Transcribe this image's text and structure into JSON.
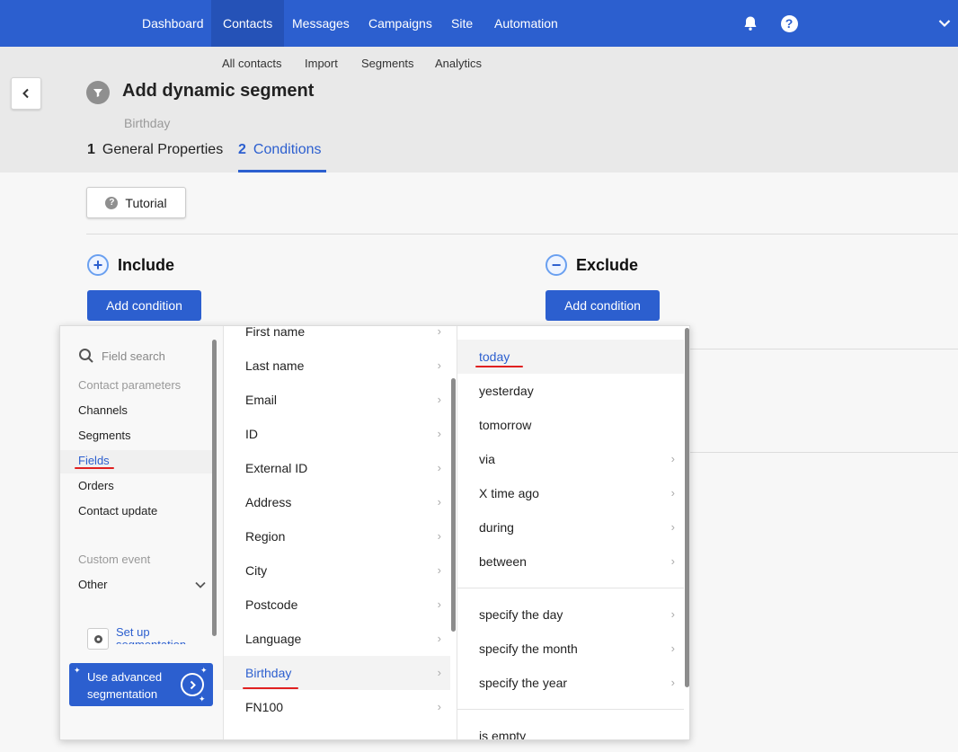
{
  "nav": {
    "items": [
      "Dashboard",
      "Contacts",
      "Messages",
      "Campaigns",
      "Site",
      "Automation"
    ],
    "active": "Contacts"
  },
  "subnav": [
    "All contacts",
    "Import",
    "Segments",
    "Analytics"
  ],
  "page": {
    "title": "Add dynamic segment",
    "subtitle": "Birthday"
  },
  "steps": [
    {
      "num": "1",
      "label": "General Properties"
    },
    {
      "num": "2",
      "label": "Conditions"
    }
  ],
  "tutorial_label": "Tutorial",
  "include": {
    "title": "Include",
    "add_label": "Add condition"
  },
  "exclude": {
    "title": "Exclude",
    "add_label": "Add condition"
  },
  "col1": {
    "search_placeholder": "Field search",
    "group1_label": "Contact parameters",
    "group1_items": [
      "Channels",
      "Segments",
      "Fields",
      "Orders",
      "Contact update"
    ],
    "active": "Fields",
    "group2_label": "Custom event",
    "other_label": "Other",
    "setup_label": "Set up segmentation",
    "advanced_label": "Use advanced segmentation"
  },
  "col2": {
    "items": [
      "First name",
      "Last name",
      "Email",
      "ID",
      "External ID",
      "Address",
      "Region",
      "City",
      "Postcode",
      "Language",
      "Birthday",
      "FN100"
    ],
    "active": "Birthday"
  },
  "col3": {
    "group1": [
      "today",
      "yesterday",
      "tomorrow",
      "via",
      "X time ago",
      "during",
      "between"
    ],
    "group2": [
      "specify the day",
      "specify the month",
      "specify the year"
    ],
    "group3": [
      "is empty"
    ],
    "active": "today"
  },
  "colors": {
    "brand": "#2c5fcf",
    "highlight_underline": "#e02020"
  }
}
